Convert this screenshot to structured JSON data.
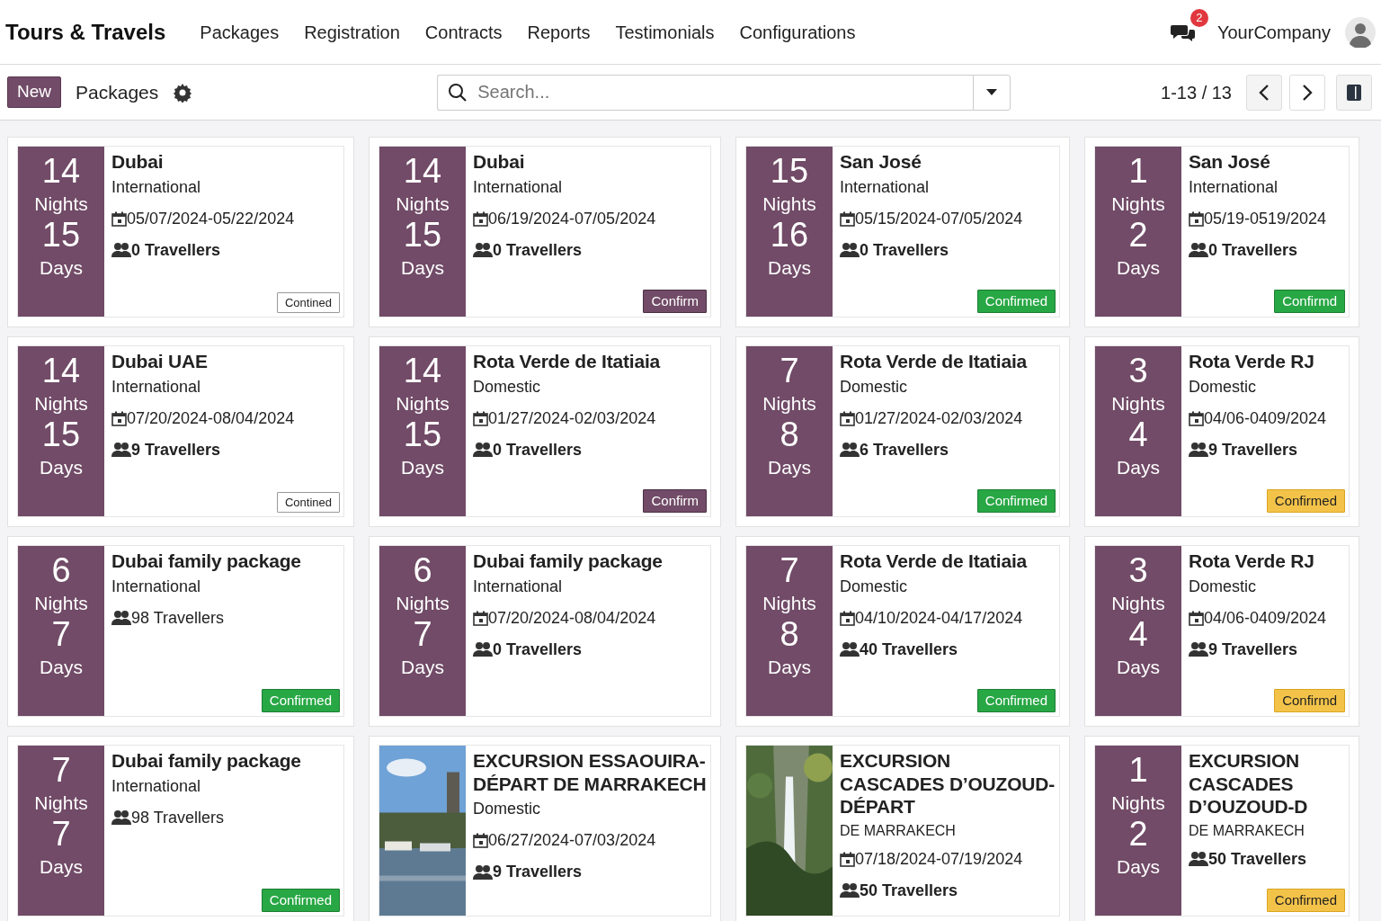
{
  "navbar": {
    "brand": "Tours & Travels",
    "menu": [
      "Packages",
      "Registration",
      "Contracts",
      "Reports",
      "Testimonials",
      "Configurations"
    ],
    "message_count": "2",
    "company": "YourCompany"
  },
  "control_panel": {
    "new_button": "New",
    "breadcrumb": "Packages",
    "search": {
      "placeholder": "Search..."
    },
    "pager": "1-13 / 13"
  },
  "cards": [
    {
      "kind": "duration",
      "nights": "14",
      "nights_label": "Nights",
      "days": "15",
      "days_label": "Days",
      "title": "Dubai",
      "type": "International",
      "dates": "05/07/2024-05/22/2024",
      "travellers": "0 Travellers",
      "travellers_bold": true,
      "status": {
        "text": "Contined",
        "kind": "outline"
      }
    },
    {
      "kind": "duration",
      "nights": "14",
      "nights_label": "Nights",
      "days": "15",
      "days_label": "Days",
      "title": "Dubai",
      "type": "International",
      "dates": "06/19/2024-07/05/2024",
      "travellers": "0 Travellers",
      "travellers_bold": true,
      "status": {
        "text": "Confirm",
        "kind": "primary"
      }
    },
    {
      "kind": "duration",
      "nights": "15",
      "nights_label": "Nights",
      "days": "16",
      "days_label": "Days",
      "title": "San José",
      "type": "International",
      "dates": "05/15/2024-07/05/2024",
      "travellers": "0 Travellers",
      "travellers_bold": true,
      "status": {
        "text": "Confirmed",
        "kind": "success"
      }
    },
    {
      "kind": "duration",
      "nights": "1",
      "nights_label": "Nights",
      "days": "2",
      "days_label": "Days",
      "title": "San José",
      "type": "International",
      "dates": "05/19-0519/2024",
      "travellers": "0 Travellers",
      "travellers_bold": true,
      "status": {
        "text": "Confirmd",
        "kind": "success"
      }
    },
    {
      "kind": "duration",
      "nights": "14",
      "nights_label": "Nights",
      "days": "15",
      "days_label": "Days",
      "title": "Dubai UAE",
      "type": "International",
      "dates": "07/20/2024-08/04/2024",
      "travellers": "9 Travellers",
      "travellers_bold": true,
      "status": {
        "text": "Contined",
        "kind": "outline"
      }
    },
    {
      "kind": "duration",
      "nights": "14",
      "nights_label": "Nights",
      "days": "15",
      "days_label": "Days",
      "title": "Rota Verde de Itatiaia",
      "type": "Domestic",
      "dates": "01/27/2024-02/03/2024",
      "travellers": "0 Travellers",
      "travellers_bold": true,
      "status": {
        "text": "Confirm",
        "kind": "primary"
      }
    },
    {
      "kind": "duration",
      "nights": "7",
      "nights_label": "Nights",
      "days": "8",
      "days_label": "Days",
      "title": "Rota Verde de Itatiaia",
      "type": "Domestic",
      "dates": "01/27/2024-02/03/2024",
      "travellers": "6 Travellers",
      "travellers_bold": true,
      "status": {
        "text": "Confirmed",
        "kind": "success"
      }
    },
    {
      "kind": "duration",
      "nights": "3",
      "nights_label": "Nights",
      "days": "4",
      "days_label": "Days",
      "title": "Rota Verde RJ",
      "type": "Domestic",
      "dates": "04/06-0409/2024",
      "travellers": "9 Travellers",
      "travellers_bold": true,
      "status": {
        "text": "Confirmed",
        "kind": "warning"
      }
    },
    {
      "kind": "duration",
      "nights": "6",
      "nights_label": "Nights",
      "days": "7",
      "days_label": "Days",
      "title": "Dubai family package",
      "type": "International",
      "travellers": "98 Travellers",
      "travellers_bold": false,
      "status": {
        "text": "Confirmed",
        "kind": "success"
      }
    },
    {
      "kind": "duration",
      "nights": "6",
      "nights_label": "Nights",
      "days": "7",
      "days_label": "Days",
      "title": "Dubai family package",
      "type": "International",
      "dates": "07/20/2024-08/04/2024",
      "travellers": "0 Travellers",
      "travellers_bold": true
    },
    {
      "kind": "duration",
      "nights": "7",
      "nights_label": "Nights",
      "days": "8",
      "days_label": "Days",
      "title": "Rota Verde de Itatiaia",
      "type": "Domestic",
      "dates": "04/10/2024-04/17/2024",
      "travellers": "40 Travellers",
      "travellers_bold": true,
      "status": {
        "text": "Confirmed",
        "kind": "success"
      }
    },
    {
      "kind": "duration",
      "nights": "3",
      "nights_label": "Nights",
      "days": "4",
      "days_label": "Days",
      "title": "Rota Verde RJ",
      "type": "Domestic",
      "dates": "04/06-0409/2024",
      "travellers": "9 Travellers",
      "travellers_bold": true,
      "status": {
        "text": "Confirmd",
        "kind": "warning"
      }
    },
    {
      "kind": "duration",
      "nights": "7",
      "nights_label": "Nights",
      "days": "7",
      "days_label": "Days",
      "title": "Dubai family package",
      "type": "International",
      "travellers": "98 Travellers",
      "travellers_bold": false,
      "status": {
        "text": "Confirmed",
        "kind": "success"
      }
    },
    {
      "kind": "picture",
      "title": "EXCURSION ESSAOUIRA-DÉPART DE MARRAKECH",
      "type": "Domestic",
      "dates": "06/27/2024-07/03/2024",
      "travellers": "9 Travellers",
      "travellers_bold": true
    },
    {
      "kind": "picture",
      "title": "EXCURSION CASCADES D’OUZOUD-DÉPART",
      "subtitle": "DE MARRAKECH",
      "dates": "07/18/2024-07/19/2024",
      "travellers": "50 Travellers",
      "travellers_bold": true
    },
    {
      "kind": "duration",
      "nights": "1",
      "nights_label": "Nights",
      "days": "2",
      "days_label": "Days",
      "title": "EXCURSION CASCADES D’OUZOUD-D",
      "subtitle": "DE MARRAKECH",
      "travellers": "50 Travellers",
      "travellers_bold": true,
      "status": {
        "text": "Confirmed",
        "kind": "warning"
      }
    }
  ]
}
